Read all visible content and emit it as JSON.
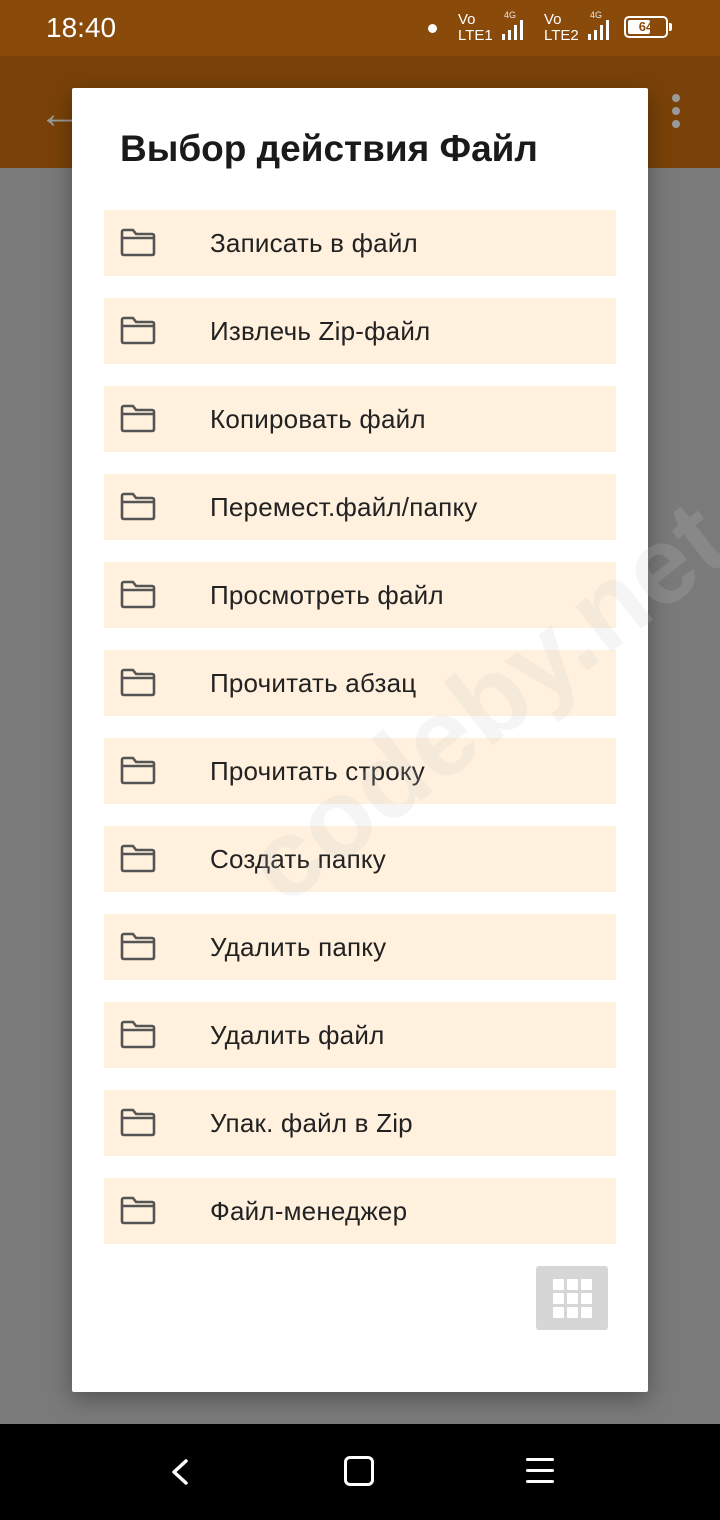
{
  "status_bar": {
    "time": "18:40",
    "sim1": {
      "vo": "Vo",
      "lte": "LTE1",
      "net": "4G"
    },
    "sim2": {
      "vo": "Vo",
      "lte": "LTE2",
      "net": "4G"
    },
    "battery": "64",
    "battery_level": 0.64
  },
  "dialog": {
    "title": "Выбор действия Файл",
    "items": [
      {
        "label": "Записать в файл",
        "icon": "folder-icon"
      },
      {
        "label": "Извлечь Zip-файл",
        "icon": "folder-icon"
      },
      {
        "label": "Копировать файл",
        "icon": "folder-icon"
      },
      {
        "label": "Перемест.файл/папку",
        "icon": "folder-icon"
      },
      {
        "label": "Просмотреть файл",
        "icon": "folder-icon"
      },
      {
        "label": "Прочитать абзац",
        "icon": "folder-icon"
      },
      {
        "label": "Прочитать строку",
        "icon": "folder-icon"
      },
      {
        "label": "Создать папку",
        "icon": "folder-icon"
      },
      {
        "label": "Удалить папку",
        "icon": "folder-icon"
      },
      {
        "label": "Удалить файл",
        "icon": "folder-icon"
      },
      {
        "label": "Упак. файл в Zip",
        "icon": "folder-icon"
      },
      {
        "label": "Файл-менеджер",
        "icon": "folder-icon"
      }
    ],
    "grid_button_icon": "grid-icon"
  },
  "watermark": "codeby.net",
  "colors": {
    "status_bar": "#8a4a0a",
    "item_background": "#fff1de",
    "grid_button": "#d6d6d6"
  }
}
